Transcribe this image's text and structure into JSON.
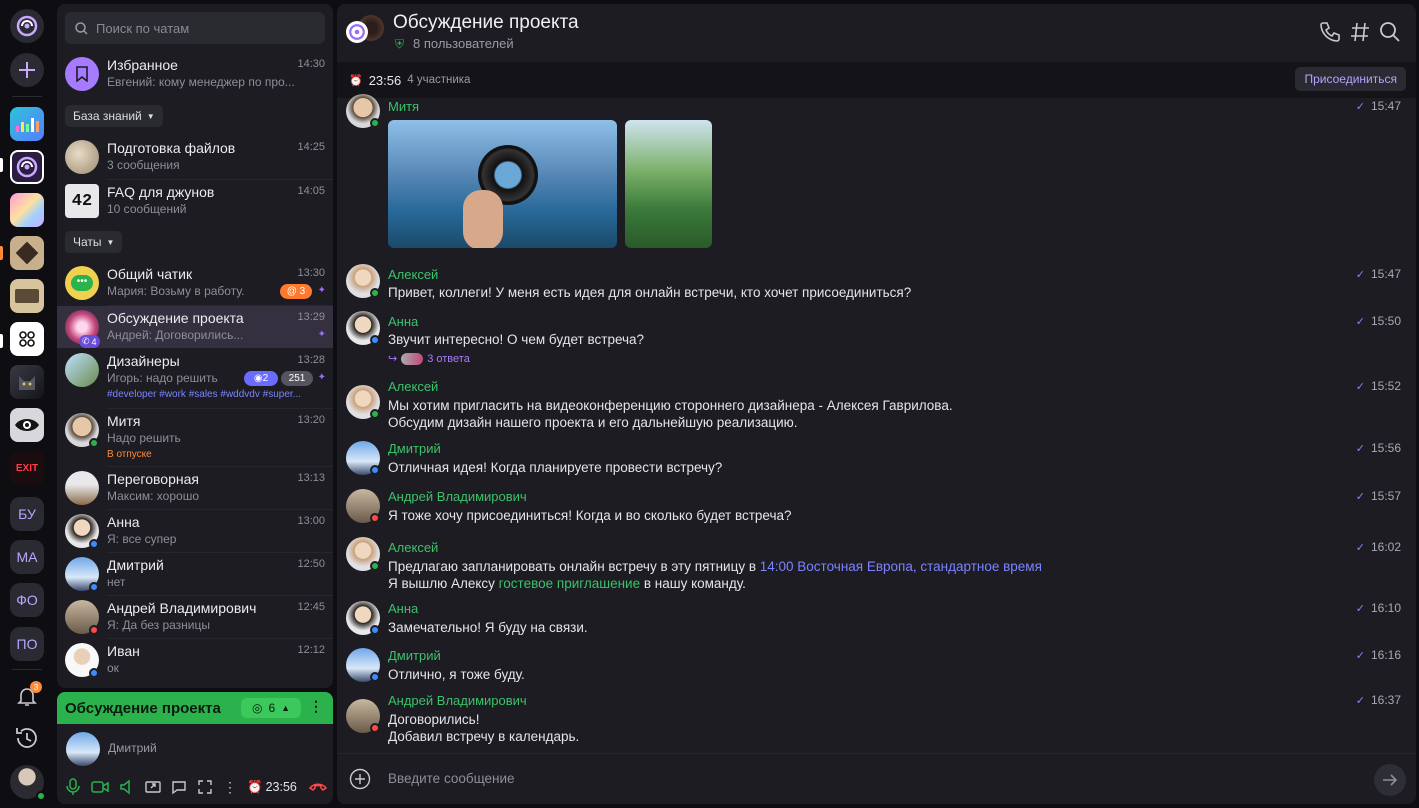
{
  "rail": {
    "items": [
      {
        "kind": "logo",
        "name": "app-logo"
      },
      {
        "kind": "add",
        "name": "add-workspace-button"
      },
      {
        "kind": "ws",
        "name": "workspace-chart"
      },
      {
        "kind": "ws",
        "name": "workspace-current"
      },
      {
        "kind": "ws",
        "name": "workspace-pastel"
      },
      {
        "kind": "ws",
        "name": "workspace-wood"
      },
      {
        "kind": "ws",
        "name": "workspace-books"
      },
      {
        "kind": "ws",
        "name": "workspace-hub"
      },
      {
        "kind": "ws",
        "name": "workspace-cat"
      },
      {
        "kind": "ws",
        "name": "workspace-eye"
      },
      {
        "kind": "ws",
        "name": "workspace-exit"
      }
    ],
    "text_workspaces": [
      "БУ",
      "МА",
      "ФО",
      "ПО"
    ],
    "notifications_count": "3"
  },
  "search": {
    "placeholder": "Поиск по чатам"
  },
  "favorites": {
    "name": "Избранное",
    "preview": "Евгений: кому менеджер по про...",
    "time": "14:30"
  },
  "sections": {
    "knowledge": "База знаний",
    "chats": "Чаты"
  },
  "knowledge_items": [
    {
      "name": "Подготовка файлов",
      "preview": "3 сообщения",
      "time": "14:25"
    },
    {
      "name": "FAQ для джунов",
      "preview": "10 сообщений",
      "time": "14:05"
    }
  ],
  "chats": [
    {
      "name": "Общий чатик",
      "preview": "Мария: Возьму в работу.",
      "time": "13:30",
      "badge": "@ 3"
    },
    {
      "name": "Обсуждение проекта",
      "preview": "Андрей: Договорились...",
      "time": "13:29",
      "call_count": "4"
    },
    {
      "name": "Дизайнеры",
      "preview": "Игорь: надо решить",
      "time": "13:28",
      "badge1": "2",
      "badge2": "251",
      "tags": "#developer #work #sales #wddvdv #super..."
    },
    {
      "name": "Митя",
      "preview": "Надо решить",
      "time": "13:20",
      "status": "В отпуске"
    },
    {
      "name": "Переговорная",
      "preview": "Максим: хорошо",
      "time": "13:13"
    },
    {
      "name": "Анна",
      "preview": "Я: все супер",
      "time": "13:00"
    },
    {
      "name": "Дмитрий",
      "preview": "нет",
      "time": "12:50"
    },
    {
      "name": "Андрей Владимирович",
      "preview": "Я: Да без разницы",
      "time": "12:45"
    },
    {
      "name": "Иван",
      "preview": "ок",
      "time": "12:12"
    }
  ],
  "call": {
    "title": "Обсуждение проекта",
    "participants": "6",
    "user": "Дмитрий",
    "timer": "23:56"
  },
  "header": {
    "title": "Обсуждение проекта",
    "users": "8 пользователей"
  },
  "callstrip": {
    "timer": "23:56",
    "participants": "4 участника",
    "join": "Присоединиться"
  },
  "messages": [
    {
      "author": "Митя",
      "time": "15:47",
      "text": ""
    },
    {
      "author": "Алексей",
      "time": "15:47",
      "text": "Привет, коллеги! У меня есть идея для онлайн встречи, кто хочет присоединиться?"
    },
    {
      "author": "Анна",
      "time": "15:50",
      "text": "Звучит интересно! О чем будет встреча?",
      "replies": "3 ответа"
    },
    {
      "author": "Алексей",
      "time": "15:52",
      "text": "Мы хотим пригласить на видеоконференцию стороннего дизайнера - Алексея Гаврилова.",
      "text2": "Обсудим дизайн нашего проекта и его дальнейшую реализацию."
    },
    {
      "author": "Дмитрий",
      "time": "15:56",
      "text": "Отличная идея! Когда планируете провести встречу?"
    },
    {
      "author": "Андрей Владимирович",
      "time": "15:57",
      "text": "Я тоже хочу присоединиться! Когда и во сколько будет встреча?"
    },
    {
      "author": "Алексей",
      "time": "16:02",
      "text_a": "Предлагаю запланировать онлайн встречу в эту пятницу в ",
      "link": "14:00 Восточная Европа, стандартное время",
      "text_b": "Я вышлю Алексу ",
      "glink": "гостевое приглашение",
      "text_c": " в нашу команду."
    },
    {
      "author": "Анна",
      "time": "16:10",
      "text": "Замечательно! Я буду на связи."
    },
    {
      "author": "Дмитрий",
      "time": "16:16",
      "text": "Отлично, я тоже буду."
    },
    {
      "author": "Андрей Владимирович",
      "time": "16:37",
      "text": "Договорились!",
      "text2": "Добавил встречу в календарь."
    }
  ],
  "composer": {
    "placeholder": "Введите сообщение"
  },
  "colors": {
    "accent": "#9b6bff",
    "green": "#2bb24c",
    "link": "#7b83ff"
  }
}
